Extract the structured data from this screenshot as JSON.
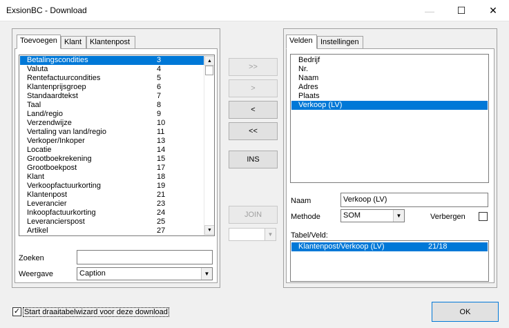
{
  "window": {
    "title": "ExsionBC - Download",
    "minimize_glyph": "—",
    "maximize_glyph": "☐",
    "close_glyph": "✕"
  },
  "left_panel": {
    "tabs": [
      "Toevoegen",
      "Klant",
      "Klantenpost"
    ],
    "active_tab": "Toevoegen",
    "list": [
      {
        "name": "Betalingscondities",
        "num": "3",
        "selected": true
      },
      {
        "name": "Valuta",
        "num": "4"
      },
      {
        "name": "Rentefactuurcondities",
        "num": "5"
      },
      {
        "name": "Klantenprijsgroep",
        "num": "6"
      },
      {
        "name": "Standaardtekst",
        "num": "7"
      },
      {
        "name": "Taal",
        "num": "8"
      },
      {
        "name": "Land/regio",
        "num": "9"
      },
      {
        "name": "Verzendwijze",
        "num": "10"
      },
      {
        "name": "Vertaling van land/regio",
        "num": "11"
      },
      {
        "name": "Verkoper/Inkoper",
        "num": "13"
      },
      {
        "name": "Locatie",
        "num": "14"
      },
      {
        "name": "Grootboekrekening",
        "num": "15"
      },
      {
        "name": "Grootboekpost",
        "num": "17"
      },
      {
        "name": "Klant",
        "num": "18"
      },
      {
        "name": "Verkoopfactuurkorting",
        "num": "19"
      },
      {
        "name": "Klantenpost",
        "num": "21"
      },
      {
        "name": "Leverancier",
        "num": "23"
      },
      {
        "name": "Inkoopfactuurkorting",
        "num": "24"
      },
      {
        "name": "Leverancierspost",
        "num": "25"
      },
      {
        "name": "Artikel",
        "num": "27"
      }
    ],
    "search_label": "Zoeken",
    "search_value": "",
    "display_label": "Weergave",
    "display_value": "Caption"
  },
  "middle_buttons": {
    "add_all": ">>",
    "add": ">",
    "remove": "<",
    "remove_all": "<<",
    "ins": "INS",
    "join": "JOIN",
    "join_select_value": ""
  },
  "right_panel": {
    "tabs": [
      "Velden",
      "Instellingen"
    ],
    "active_tab": "Velden",
    "fields": [
      {
        "name": "Bedrijf"
      },
      {
        "name": "Nr."
      },
      {
        "name": "Naam"
      },
      {
        "name": "Adres"
      },
      {
        "name": "Plaats"
      },
      {
        "name": "Verkoop (LV)",
        "selected": true
      }
    ],
    "name_label": "Naam",
    "name_value": "Verkoop (LV)",
    "method_label": "Methode",
    "method_value": "SOM",
    "hide_label": "Verbergen",
    "hide_checked": false,
    "table_field_label": "Tabel/Veld:",
    "table_field_rows": [
      {
        "name": "Klantenpost/Verkoop (LV)",
        "ref": "21/18",
        "selected": true
      }
    ]
  },
  "footer": {
    "pivot_checkbox_checked": true,
    "pivot_checkbox_label": "Start draaitabelwizard voor deze download",
    "ok_label": "OK"
  },
  "icons": {
    "scroll_up": "▲",
    "scroll_down": "▼",
    "dropdown": "▼",
    "check": "✓"
  }
}
